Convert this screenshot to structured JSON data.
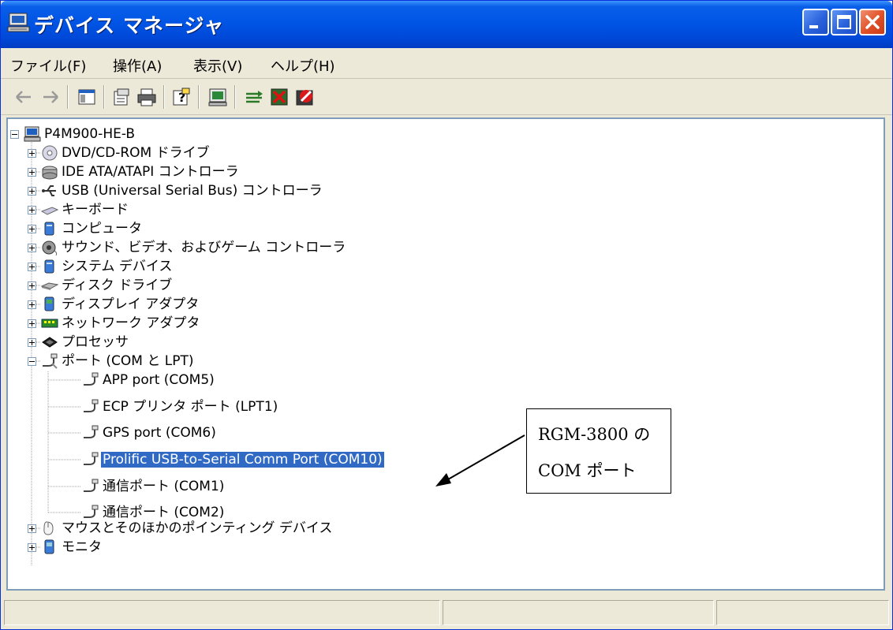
{
  "window": {
    "title": "デバイス マネージャ"
  },
  "menu": [
    "ファイル(F)",
    "操作(A)",
    "表示(V)",
    "ヘルプ(H)"
  ],
  "toolbar": {
    "buttons": [
      "back-icon",
      "forward-icon",
      "console-tree-icon",
      "properties-icon",
      "print-icon",
      "help-icon",
      "scan-hardware-icon",
      "update-driver-icon",
      "uninstall-icon",
      "disable-icon"
    ]
  },
  "tree": {
    "root": "P4M900-HE-B",
    "categories": [
      "DVD/CD-ROM ドライブ",
      "IDE ATA/ATAPI コントローラ",
      "USB (Universal Serial Bus) コントローラ",
      "キーボード",
      "コンピュータ",
      "サウンド、ビデオ、およびゲーム コントローラ",
      "システム デバイス",
      "ディスク ドライブ",
      "ディスプレイ アダプタ",
      "ネットワーク アダプタ",
      "プロセッサ",
      "ポート (COM と LPT)",
      "マウスとそのほかのポインティング デバイス",
      "モニタ"
    ],
    "ports": [
      "APP port (COM5)",
      "ECP プリンタ ポート (LPT1)",
      "GPS port (COM6)",
      "Prolific USB-to-Serial Comm Port (COM10)",
      "通信ポート (COM1)",
      "通信ポート (COM2)"
    ],
    "selected": "Prolific USB-to-Serial Comm Port (COM10)"
  },
  "annotation": {
    "line1": "RGM-3800 の",
    "line2": "COM ポート"
  },
  "colors": {
    "title_bar": "#0055e5",
    "selection": "#316ac5",
    "window_bg": "#ece9d8"
  }
}
